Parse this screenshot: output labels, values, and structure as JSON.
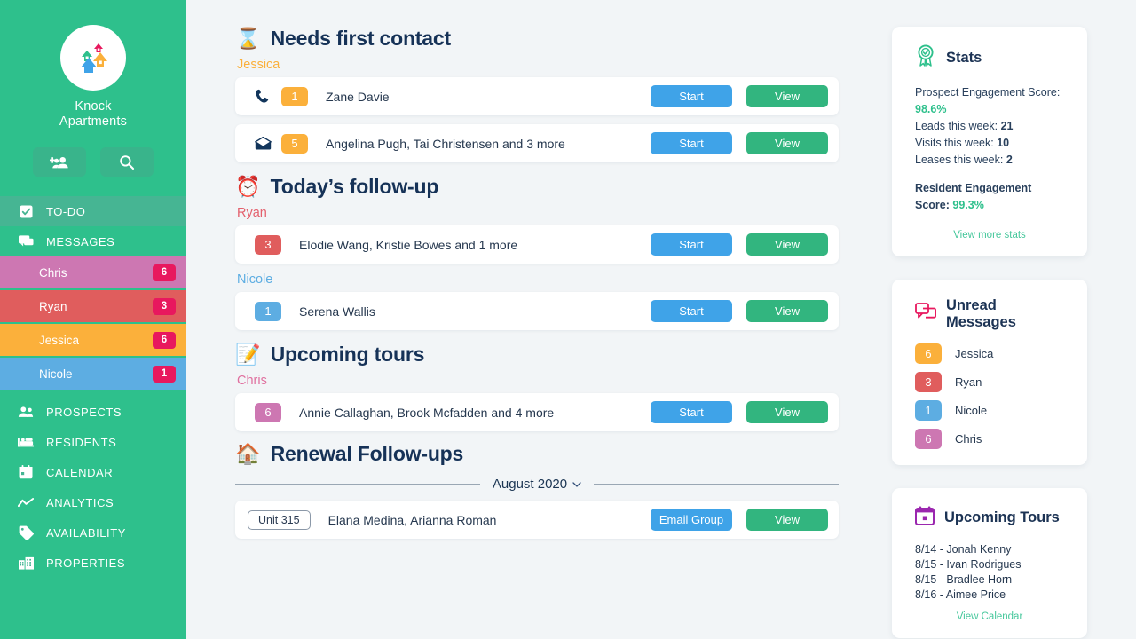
{
  "sidebar": {
    "brand_line1": "Knock",
    "brand_line2": "Apartments",
    "actions": [
      {
        "name": "add-user-button",
        "icon": "add-user-icon"
      },
      {
        "name": "search-button",
        "icon": "search-icon"
      }
    ],
    "nav": [
      {
        "label": "TO-DO",
        "icon": "checkbox-icon",
        "active": true
      },
      {
        "label": "MESSAGES",
        "icon": "chat-icon",
        "active": false
      }
    ],
    "users": [
      {
        "label": "Chris",
        "count": "6",
        "color": "#cd77b2"
      },
      {
        "label": "Ryan",
        "count": "3",
        "color": "#e05d5d"
      },
      {
        "label": "Jessica",
        "count": "6",
        "color": "#fbb03b"
      },
      {
        "label": "Nicole",
        "count": "1",
        "color": "#5dade2"
      }
    ],
    "nav_bottom": [
      {
        "label": "PROSPECTS",
        "icon": "people-icon"
      },
      {
        "label": "RESIDENTS",
        "icon": "bed-icon"
      },
      {
        "label": "CALENDAR",
        "icon": "calendar-icon"
      },
      {
        "label": "ANALYTICS",
        "icon": "chart-line-icon"
      },
      {
        "label": "AVAILABILITY",
        "icon": "tag-icon"
      },
      {
        "label": "PROPERTIES",
        "icon": "building-icon"
      }
    ],
    "badge_color": "#e8185e",
    "bg_color": "#2ec08c"
  },
  "main": {
    "sections": [
      {
        "title": "Needs first contact",
        "emoji": "⌛",
        "emoji_name": "hourglass-icon",
        "groups": [
          {
            "owner": "Jessica",
            "owner_color": "#fbb03b",
            "rows": [
              {
                "icon": "phone-icon",
                "badge": "1",
                "badge_color": "#fbb03b",
                "name": "Zane Davie",
                "primary_label": "Start",
                "secondary_label": "View"
              },
              {
                "icon": "envelope-icon",
                "badge": "5",
                "badge_color": "#fbb03b",
                "name": "Angelina Pugh, Tai Christensen and 3 more",
                "primary_label": "Start",
                "secondary_label": "View"
              }
            ]
          }
        ]
      },
      {
        "title": "Today’s follow-up",
        "emoji": "⏰",
        "emoji_name": "alarm-clock-icon",
        "groups": [
          {
            "owner": "Ryan",
            "owner_color": "#e4606d",
            "rows": [
              {
                "icon": "none",
                "badge": "3",
                "badge_color": "#e05d5d",
                "name": "Elodie Wang, Kristie Bowes and 1 more",
                "primary_label": "Start",
                "secondary_label": "View"
              }
            ]
          },
          {
            "owner": "Nicole",
            "owner_color": "#5dade2",
            "rows": [
              {
                "icon": "none",
                "badge": "1",
                "badge_color": "#5dade2",
                "name": "Serena Wallis",
                "primary_label": "Start",
                "secondary_label": "View"
              }
            ]
          }
        ]
      },
      {
        "title": "Upcoming tours",
        "emoji": "📝",
        "emoji_name": "memo-icon",
        "groups": [
          {
            "owner": "Chris",
            "owner_color": "#e0709f",
            "rows": [
              {
                "icon": "none",
                "badge": "6",
                "badge_color": "#cd77b2",
                "name": "Annie Callaghan, Brook Mcfadden and 4 more",
                "primary_label": "Start",
                "secondary_label": "View"
              }
            ]
          }
        ]
      }
    ],
    "renewal": {
      "title": "Renewal Follow-ups",
      "emoji": "🏠",
      "emoji_name": "house-icon",
      "month": "August 2020",
      "caret": "⌄",
      "rows": [
        {
          "unit": "Unit 315",
          "name": "Elana Medina, Arianna Roman",
          "primary_label": "Email Group",
          "secondary_label": "View"
        }
      ]
    }
  },
  "rail": {
    "stats": {
      "title": "Stats",
      "icon": "award-ribbon-icon",
      "prospect_label": "Prospect Engagement Score:",
      "prospect_value": "98.6%",
      "leads_label": "Leads this week:",
      "leads_value": "21",
      "visits_label": "Visits this week:",
      "visits_value": "10",
      "leases_label": "Leases this week:",
      "leases_value": "2",
      "resident_label": "Resident Engagement Score:",
      "resident_value": "99.3%",
      "link": "View more stats"
    },
    "unread": {
      "title": "Unread Messages",
      "icon": "chat-bubbles-icon",
      "items": [
        {
          "count": "6",
          "name": "Jessica",
          "color": "#fbb03b"
        },
        {
          "count": "3",
          "name": "Ryan",
          "color": "#e05d5d"
        },
        {
          "count": "1",
          "name": "Nicole",
          "color": "#5dade2"
        },
        {
          "count": "6",
          "name": "Chris",
          "color": "#cd77b2"
        }
      ]
    },
    "tours": {
      "title": "Upcoming Tours",
      "icon": "calendar-icon",
      "items": [
        "8/14 - Jonah Kenny",
        "8/15 - Ivan Rodrigues",
        "8/15 - Bradlee Horn",
        "8/16 - Aimee Price"
      ],
      "link": "View Calendar"
    }
  }
}
